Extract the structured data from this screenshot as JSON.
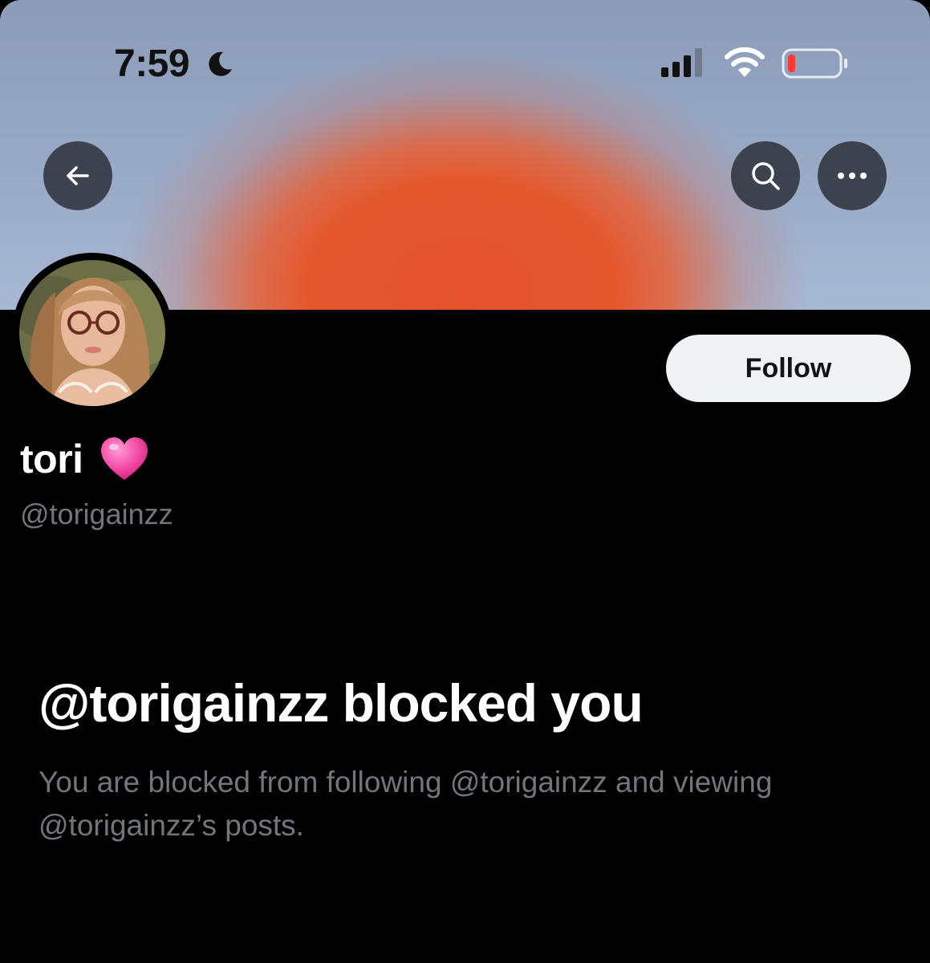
{
  "status_bar": {
    "time": "7:59",
    "icons": [
      "moon-icon",
      "cellular-signal-icon",
      "wifi-icon",
      "battery-low-icon"
    ],
    "battery_color": "#ff3b30"
  },
  "header": {
    "back_icon": "arrow-left-icon",
    "search_icon": "search-icon",
    "more_icon": "more-horizontal-icon",
    "banner_colors": {
      "sky": "#98aac6",
      "sun": "#e4532c"
    }
  },
  "profile": {
    "display_name": "tori",
    "name_emoji": "pink-heart-icon",
    "handle": "@torigainzz",
    "follow_label": "Follow"
  },
  "blocked": {
    "title": "@torigainzz blocked you",
    "description": "You are blocked from following @torigainzz and viewing @torigainzz’s posts."
  },
  "colors": {
    "background": "#000000",
    "primary_text": "#ffffff",
    "secondary_text": "#71767b",
    "follow_bg": "#eff3f4",
    "follow_text": "#0f1419"
  }
}
